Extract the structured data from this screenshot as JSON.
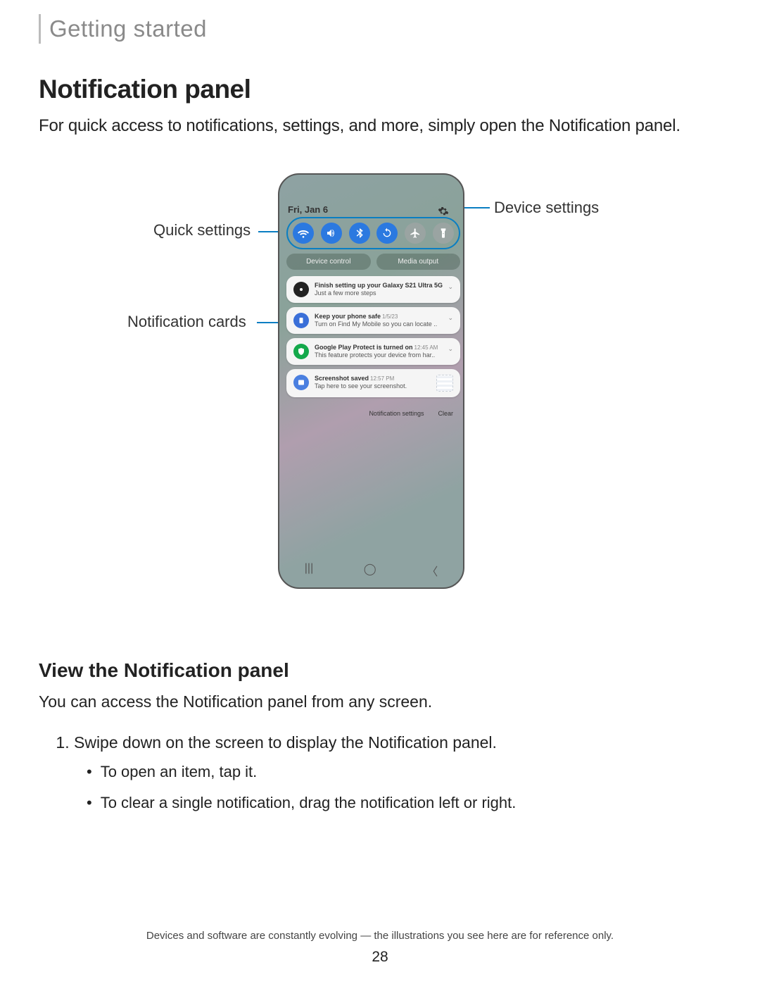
{
  "breadcrumb": "Getting started",
  "h1": "Notification panel",
  "intro": "For quick access to notifications, settings, and more, simply open the Notification panel.",
  "callouts": {
    "device_settings": "Device settings",
    "quick_settings": "Quick settings",
    "notification_cards": "Notification cards"
  },
  "phone": {
    "date": "Fri, Jan 6",
    "quick_settings_icons": [
      "wifi",
      "sound",
      "bluetooth",
      "rotate",
      "airplane",
      "flashlight"
    ],
    "pills": {
      "device_control": "Device control",
      "media_output": "Media output"
    },
    "cards": [
      {
        "icon": "gear",
        "icon_bg": "#222",
        "title": "Finish setting up your Galaxy S21 Ultra 5G",
        "meta": "",
        "sub": "Just a few more steps",
        "chev": "down"
      },
      {
        "icon": "phone-shield",
        "icon_bg": "#3a6fd8",
        "title": "Keep your phone safe",
        "meta": "1/5/23",
        "sub": "Turn on Find My Mobile so you can locate ..",
        "chev": "small"
      },
      {
        "icon": "shield",
        "icon_bg": "#14a94b",
        "title": "Google Play Protect is turned on",
        "meta": "12:45 AM",
        "sub": "This feature protects your device from har..",
        "chev": "small"
      },
      {
        "icon": "image",
        "icon_bg": "#4a7fe0",
        "title": "Screenshot saved",
        "meta": "12:57 PM",
        "sub": "Tap here to see your screenshot.",
        "thumb": true
      }
    ],
    "footer_links": {
      "settings": "Notification settings",
      "clear": "Clear"
    }
  },
  "h2": "View the Notification panel",
  "body": "You can access the Notification panel from any screen.",
  "steps": {
    "n1": "Swipe down on the screen to display the Notification panel.",
    "b1": "To open an item, tap it.",
    "b2": "To clear a single notification, drag the notification left or right."
  },
  "disclaimer": "Devices and software are constantly evolving — the illustrations you see here are for reference only.",
  "page": "28"
}
